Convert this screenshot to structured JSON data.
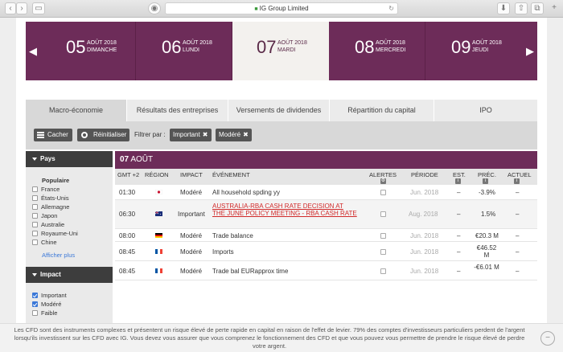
{
  "browser": {
    "url": "IG Group Limited"
  },
  "dates": [
    {
      "num": "05",
      "month": "AOÛT 2018",
      "day": "DIMANCHE"
    },
    {
      "num": "06",
      "month": "AOÛT 2018",
      "day": "LUNDI"
    },
    {
      "num": "07",
      "month": "AOÛT 2018",
      "day": "MARDI"
    },
    {
      "num": "08",
      "month": "AOÛT 2018",
      "day": "MERCREDI"
    },
    {
      "num": "09",
      "month": "AOÛT 2018",
      "day": "JEUDI"
    }
  ],
  "tabs": [
    "Macro-économie",
    "Résultats des entreprises",
    "Versements de dividendes",
    "Répartition du capital",
    "IPO"
  ],
  "filters": {
    "hide_label": "Cacher",
    "reset_label": "Réinitialiser",
    "filter_by": "Filtrer par :",
    "chips": [
      "Important",
      "Modéré"
    ]
  },
  "sidebar": {
    "country_title": "Pays",
    "popular": "Populaire",
    "countries": [
      "France",
      "États-Unis",
      "Allemagne",
      "Japon",
      "Australie",
      "Royaume-Uni",
      "Chine"
    ],
    "show_more": "Afficher plus",
    "impact_title": "Impact",
    "impacts": [
      {
        "label": "Important",
        "checked": true
      },
      {
        "label": "Modéré",
        "checked": true
      },
      {
        "label": "Faible",
        "checked": false
      }
    ]
  },
  "table": {
    "day_num": "07",
    "day_month": "AOÛT",
    "headers": {
      "time": "GMT +2",
      "region": "RÉGION",
      "impact": "IMPACT",
      "event": "ÉVÉNEMENT",
      "alerts": "ALERTES",
      "period": "PÉRIODE",
      "est": "EST.",
      "prev": "PRÉC.",
      "actual": "ACTUEL"
    },
    "rows": [
      {
        "time": "01:30",
        "flag": "japan",
        "impact": "Modéré",
        "event": "All household spding yy",
        "period": "Jun. 2018",
        "est": "–",
        "prev": "-3.9%",
        "actual": "–"
      },
      {
        "time": "06:30",
        "flag": "australia",
        "impact": "Important",
        "event": "AUSTRALIA-RBA CASH RATE DECISION AT THE JUNE POLICY MEETING - RBA CASH RATE",
        "period": "Aug. 2018",
        "est": "–",
        "prev": "1.5%",
        "actual": "–"
      },
      {
        "time": "08:00",
        "flag": "germany",
        "impact": "Modéré",
        "event": "Trade balance",
        "period": "Jun. 2018",
        "est": "–",
        "prev": "€20.3 M",
        "actual": "–"
      },
      {
        "time": "08:45",
        "flag": "france",
        "impact": "Modéré",
        "event": "Imports",
        "period": "Jun. 2018",
        "est": "–",
        "prev": "€46.52 M",
        "actual": "–"
      },
      {
        "time": "08:45",
        "flag": "france",
        "impact": "Modéré",
        "event": "Trade bal EURapprox time",
        "period": "Jun. 2018",
        "est": "–",
        "prev": "-€6.01 M",
        "actual": "–"
      }
    ]
  },
  "notice": {
    "text": "Les CFD sont des instruments complexes et présentent un risque élevé de perte rapide en capital en raison de l'effet de levier. 79% des comptes d'investisseurs particuliers perdent de l'argent lorsqu'ils investissent sur les CFD avec IG. Vous devez vous assurer que vous comprenez le fonctionnement des CFD et que vous pouvez vous permettre de prendre le risque élevé de perdre votre argent.",
    "close": "−"
  },
  "colors": {
    "brand": "#6d2c59",
    "link": "#3b78d8",
    "alert": "#d12a2a"
  }
}
